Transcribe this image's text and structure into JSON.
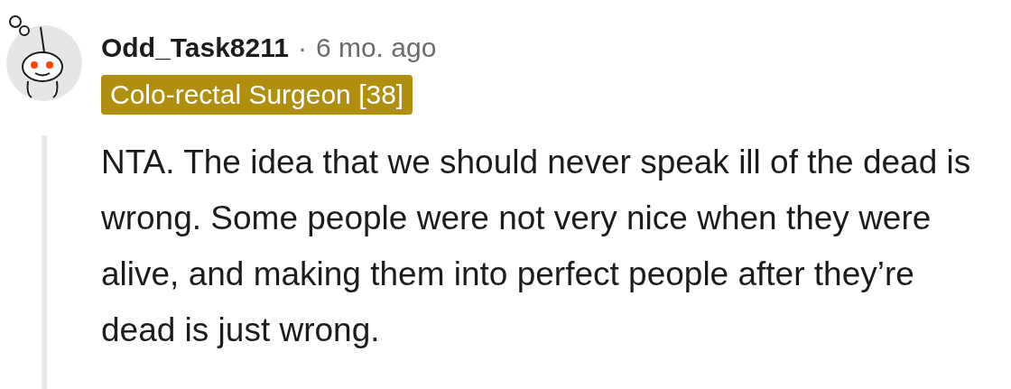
{
  "comment": {
    "author": "Odd_Task8211",
    "separator": "·",
    "time": "6 mo. ago",
    "flair": {
      "text": "Colo-rectal Surgeon [38]",
      "color": "#b08f0e"
    },
    "body": "NTA. The idea that we should never speak ill of the dead is wrong. Some people were not very nice when they were alive, and making them into perfect people after they’re dead is just wrong."
  }
}
